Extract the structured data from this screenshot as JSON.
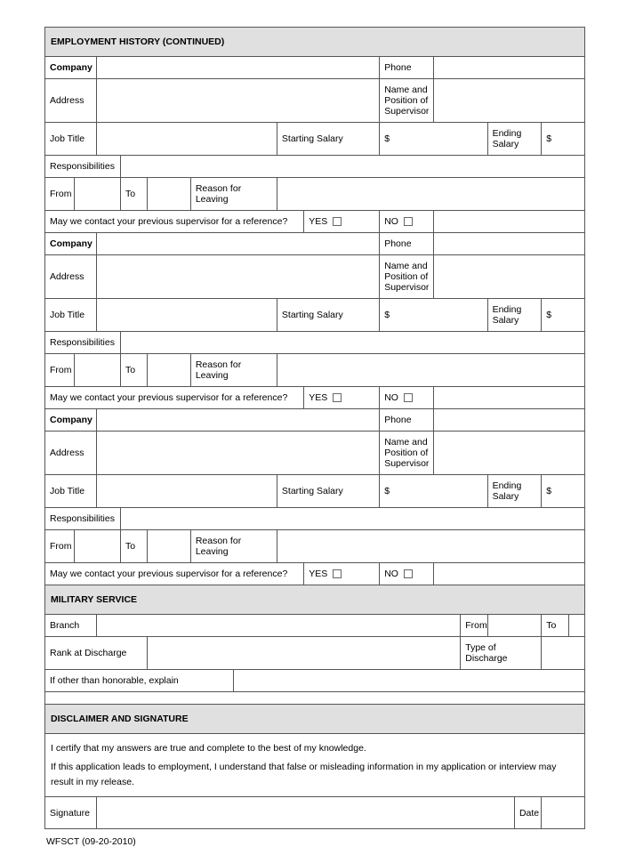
{
  "headers": {
    "employment_history": "EMPLOYMENT HISTORY     (CONTINUED)",
    "military_service": "MILITARY SERVICE",
    "disclaimer_signature": "DISCLAIMER AND SIGNATURE"
  },
  "labels": {
    "company": "Company",
    "phone": "Phone",
    "address": "Address",
    "name_position_supervisor": "Name and Position of Supervisor",
    "job_title": "Job Title",
    "starting_salary": "Starting Salary",
    "dollar": "$",
    "ending_salary": "Ending Salary",
    "responsibilities": "Responsibilities",
    "from": "From",
    "to": "To",
    "reason_leaving": "Reason for Leaving",
    "contact_supervisor": "May we contact your previous supervisor for a reference?",
    "yes": "YES",
    "no": "NO",
    "branch": "Branch",
    "rank_discharge": "Rank at Discharge",
    "type_discharge": "Type of Discharge",
    "other_honorable": "If other than honorable, explain",
    "signature": "Signature",
    "date": "Date"
  },
  "disclaimer": {
    "line1": "I certify that my answers are true and complete to the best of my knowledge.",
    "line2": "If this application leads to employment, I understand that false or misleading information in my application or interview may result in my release."
  },
  "footer": "WFSCT   (09-20-2010)"
}
